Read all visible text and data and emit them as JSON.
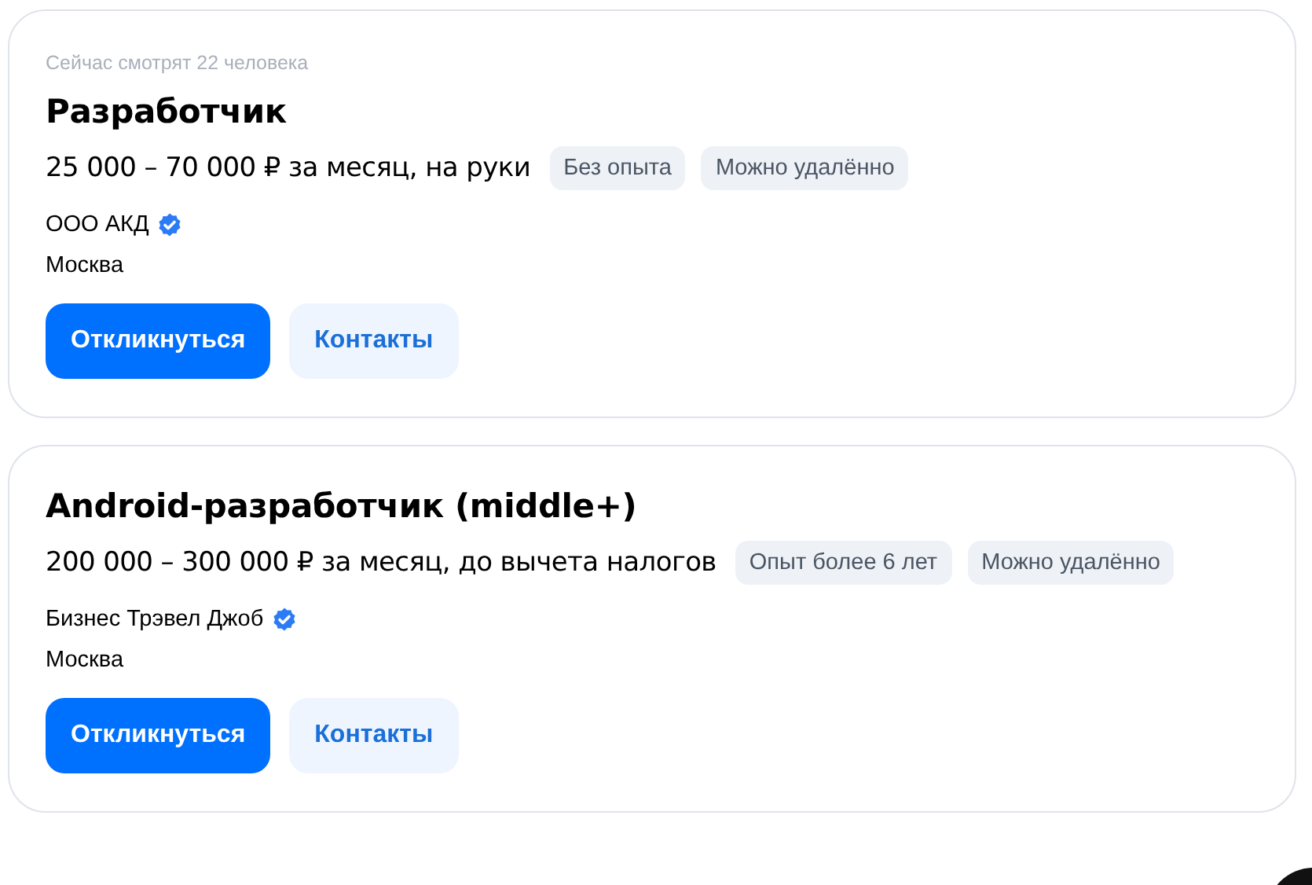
{
  "vacancies": [
    {
      "viewers": "Сейчас смотрят 22 человека",
      "title": "Разработчик",
      "salary": "25 000 – 70 000 ₽ за месяц, на руки",
      "tags": [
        "Без опыта",
        "Можно удалённо"
      ],
      "company": "ООО АКД",
      "verified": true,
      "city": "Москва",
      "buttons": [
        {
          "label": "Откликнуться",
          "kind": "primary"
        },
        {
          "label": "Контакты",
          "kind": "secondary"
        }
      ]
    },
    {
      "title": "Android-разработчик (middle+)",
      "salary": "200 000 – 300 000 ₽ за месяц, до вычета налогов",
      "tags": [
        "Опыт более 6 лет",
        "Можно удалённо"
      ],
      "company": "Бизнес Трэвел Джоб",
      "verified": true,
      "city": "Москва",
      "buttons": [
        {
          "label": "Откликнуться",
          "kind": "primary"
        },
        {
          "label": "Контакты",
          "kind": "secondary"
        }
      ]
    }
  ]
}
